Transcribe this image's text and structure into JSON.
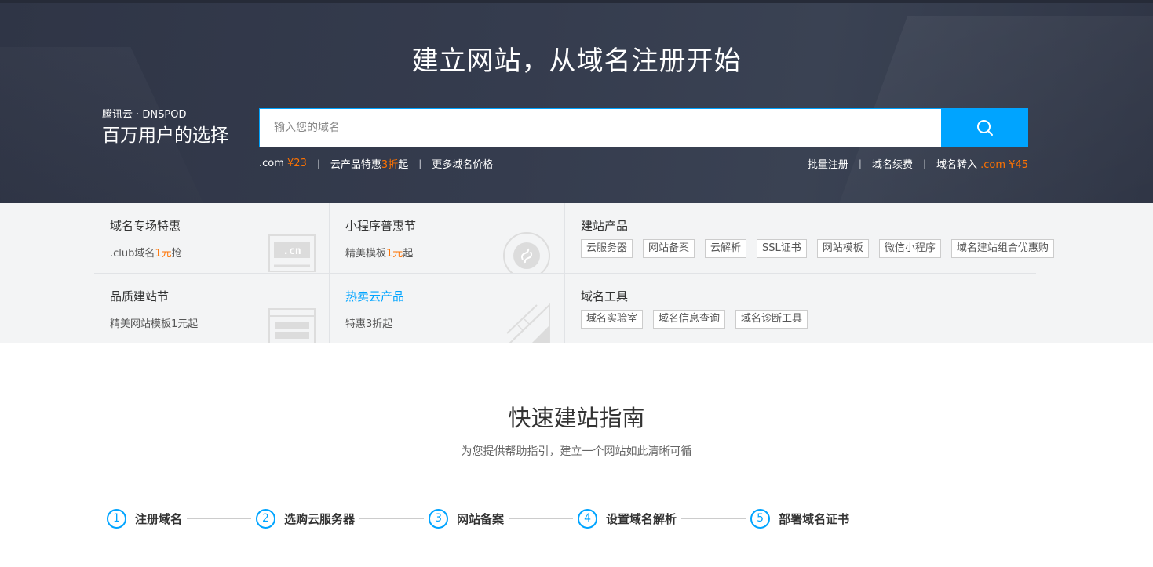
{
  "hero": {
    "title": "建立网站，从域名注册开始",
    "brand_small": "腾讯云 · DNSPOD",
    "brand_big": "百万用户的选择",
    "search_placeholder": "输入您的域名",
    "quick_left": [
      {
        "prefix": ".com ",
        "highlight": "¥23",
        "suffix": ""
      },
      {
        "prefix": "云产品特惠",
        "highlight": "3折",
        "suffix": "起"
      },
      {
        "prefix": "更多域名价格",
        "highlight": "",
        "suffix": ""
      }
    ],
    "quick_right": [
      {
        "prefix": "批量注册",
        "highlight": ""
      },
      {
        "prefix": "域名续费",
        "highlight": ""
      },
      {
        "prefix": "域名转入 ",
        "highlight": ".com ¥45"
      }
    ],
    "accent_color": "#00a4ff",
    "highlight_color": "#ff7200"
  },
  "promo": {
    "cells": [
      {
        "title": "域名专场特惠",
        "sub_prefix": ".club域名",
        "sub_highlight": "1元",
        "sub_suffix": "抢",
        "icon": "cn-domain-icon",
        "icon_text": ".cn"
      },
      {
        "title": "小程序普惠节",
        "sub_prefix": "精美模板",
        "sub_highlight": "1元",
        "sub_suffix": "起",
        "icon": "mini-program-icon"
      },
      {
        "title": "品质建站节",
        "sub_prefix": "精美网站模板1元起",
        "sub_highlight": "",
        "sub_suffix": "",
        "icon": "website-template-icon"
      },
      {
        "title": "热卖云产品",
        "sub_prefix": "特惠3折起",
        "sub_highlight": "",
        "sub_suffix": "",
        "icon": "ruler-pencil-icon"
      }
    ],
    "site_products": {
      "title": "建站产品",
      "tags": [
        "云服务器",
        "网站备案",
        "云解析",
        "SSL证书",
        "网站模板",
        "微信小程序",
        "域名建站组合优惠购"
      ]
    },
    "domain_tools": {
      "title": "域名工具",
      "tags": [
        "域名实验室",
        "域名信息查询",
        "域名诊断工具"
      ]
    }
  },
  "guide": {
    "title": "快速建站指南",
    "subtitle": "为您提供帮助指引，建立一个网站如此清晰可循",
    "steps": [
      {
        "num": "1",
        "label": "注册域名"
      },
      {
        "num": "2",
        "label": "选购云服务器"
      },
      {
        "num": "3",
        "label": "网站备案"
      },
      {
        "num": "4",
        "label": "设置域名解析"
      },
      {
        "num": "5",
        "label": "部署域名证书"
      }
    ]
  }
}
